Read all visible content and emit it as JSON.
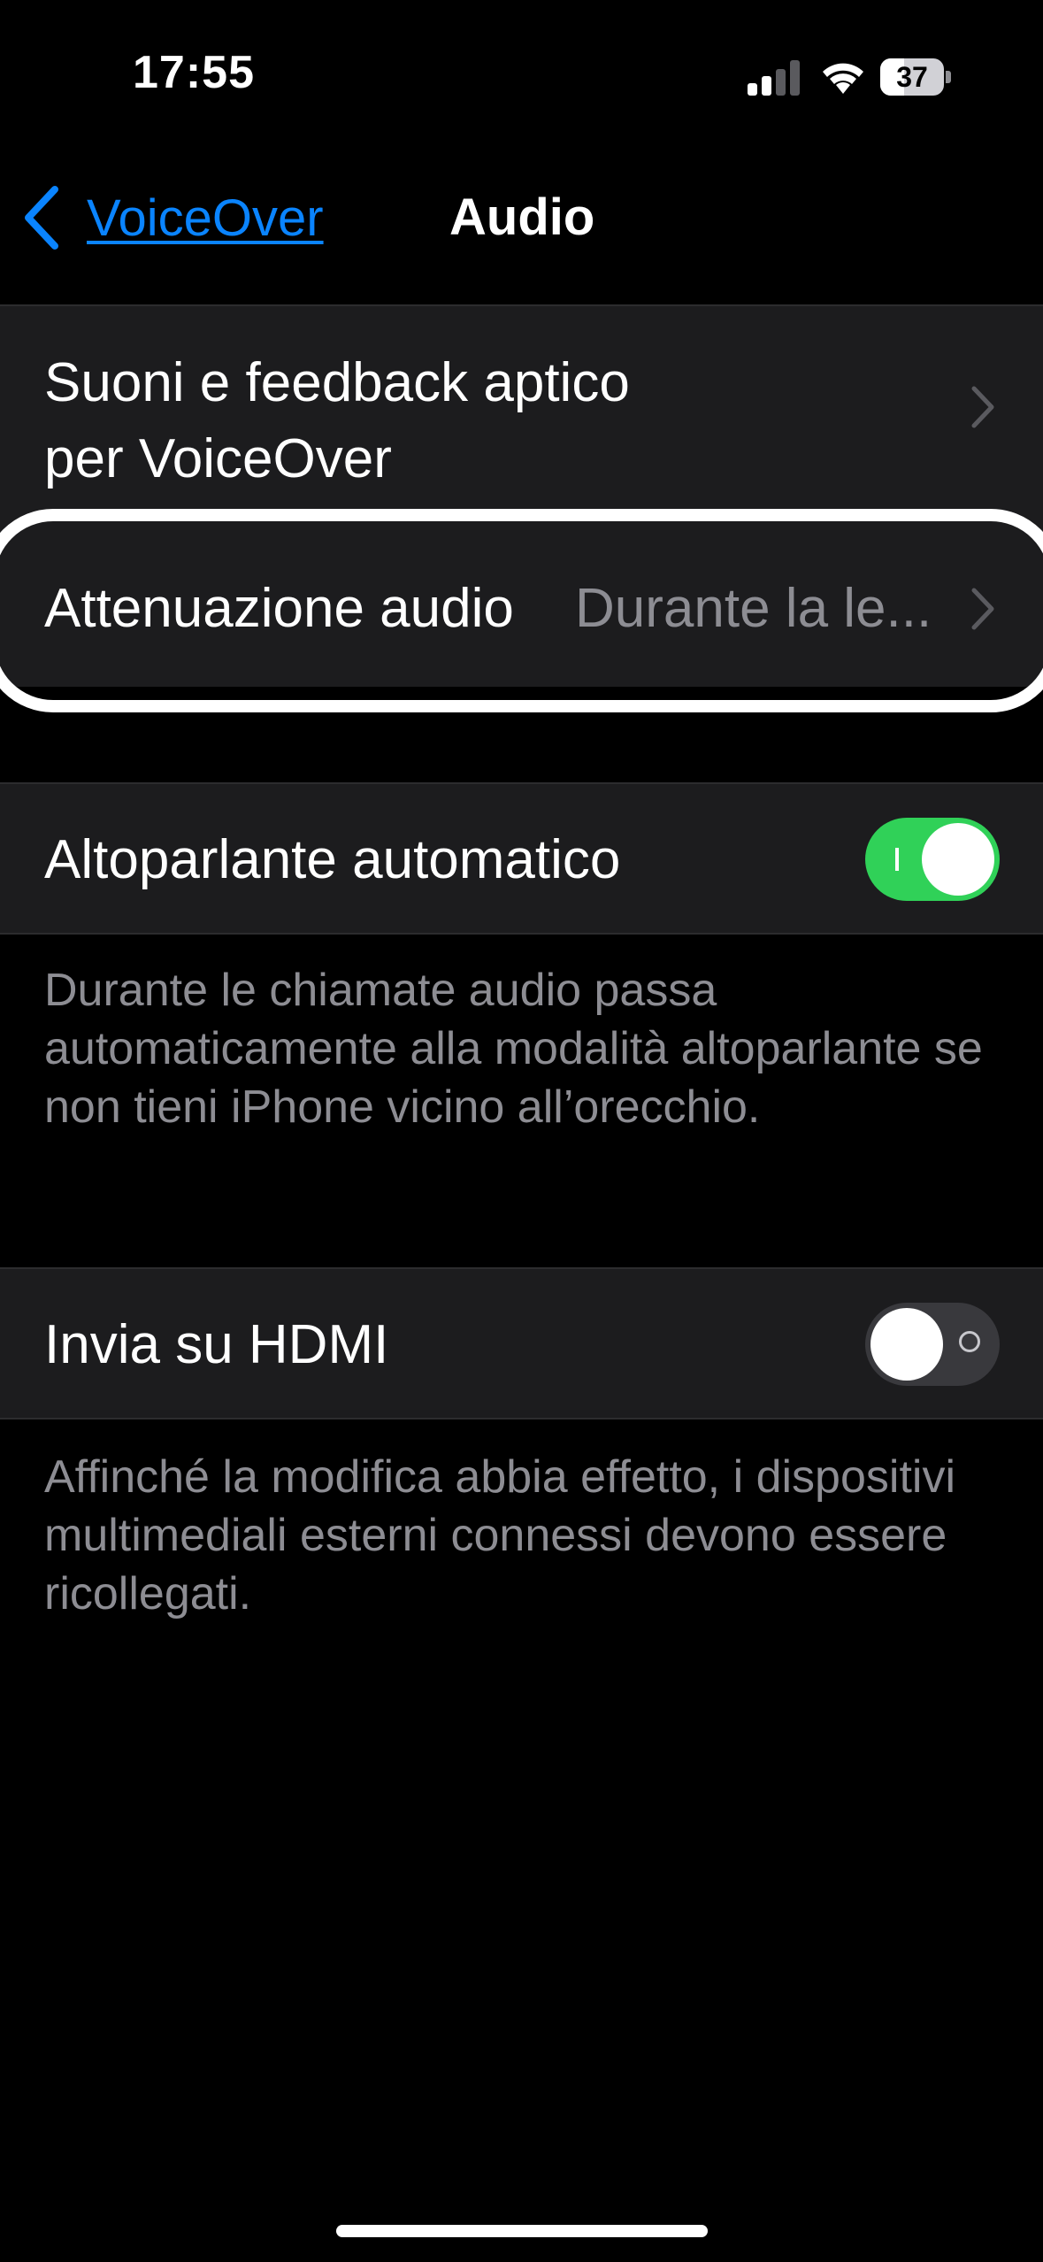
{
  "status_bar": {
    "time": "17:55",
    "battery_level": "37"
  },
  "nav": {
    "back_label": "VoiceOver",
    "title": "Audio"
  },
  "rows": {
    "sounds_haptics": {
      "label_line1": "Suoni e feedback aptico",
      "label_line2": "per VoiceOver"
    },
    "audio_ducking": {
      "label": "Attenuazione audio",
      "value": "Durante la le..."
    },
    "auto_speaker": {
      "label": "Altoparlante automatico",
      "enabled": true,
      "footer": "Durante le chiamate audio passa automaticamente alla modalità altoparlante se non tieni iPhone vicino all’orecchio."
    },
    "hdmi": {
      "label": "Invia su HDMI",
      "enabled": false,
      "footer": "Affinché la modifica abbia effetto, i dispositivi multimediali esterni connessi devono essere ricollegati."
    }
  },
  "colors": {
    "accent": "#0a84ff",
    "toggle_on": "#30d158",
    "toggle_off": "#39393d",
    "group_bg": "#1c1c1e",
    "secondary_text": "#8d8d93"
  }
}
